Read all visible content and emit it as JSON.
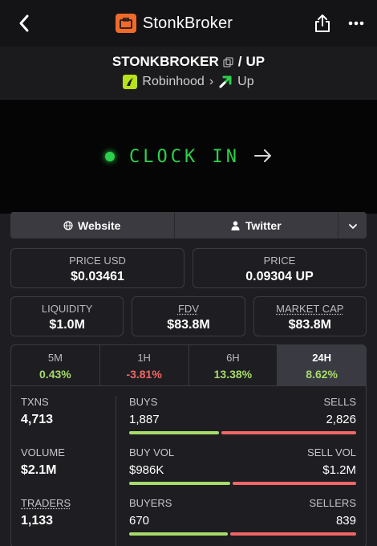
{
  "app": {
    "name": "StonkBroker"
  },
  "pair": {
    "base": "STONKBROKER",
    "separator": "/",
    "quote": "UP",
    "dex": "Robinhood",
    "chain": "Up"
  },
  "banner": {
    "text": "CLOCK IN"
  },
  "links": {
    "website": "Website",
    "twitter": "Twitter"
  },
  "prices": {
    "usd_label": "PRICE USD",
    "usd_value": "$0.03461",
    "native_label": "PRICE",
    "native_value": "0.09304 UP"
  },
  "market": {
    "liquidity_label": "LIQUIDITY",
    "liquidity_value": "$1.0M",
    "fdv_label": "FDV",
    "fdv_value": "$83.8M",
    "mcap_label": "MARKET CAP",
    "mcap_value": "$83.8M"
  },
  "timeframes": [
    {
      "label": "5M",
      "value": "0.43%",
      "trend": "pos"
    },
    {
      "label": "1H",
      "value": "-3.81%",
      "trend": "neg"
    },
    {
      "label": "6H",
      "value": "13.38%",
      "trend": "pos"
    },
    {
      "label": "24H",
      "value": "8.62%",
      "trend": "pos"
    }
  ],
  "active_timeframe": "24H",
  "metrics": {
    "txns_label": "TXNS",
    "txns_value": "4,713",
    "volume_label": "VOLUME",
    "volume_value": "$2.1M",
    "traders_label": "TRADERS",
    "traders_value": "1,133",
    "buys_label": "BUYS",
    "buys_value": "1,887",
    "sells_label": "SELLS",
    "sells_value": "2,826",
    "buys_fraction": 0.4,
    "buyvol_label": "BUY VOL",
    "buyvol_value": "$986K",
    "sellvol_label": "SELL VOL",
    "sellvol_value": "$1.2M",
    "buyvol_fraction": 0.45,
    "buyers_label": "BUYERS",
    "buyers_value": "670",
    "sellers_label": "SELLERS",
    "sellers_value": "839",
    "buyers_fraction": 0.44
  },
  "colors": {
    "accent_green": "#2bd14a",
    "positive": "#a7db6a",
    "negative": "#f26666",
    "brand_orange": "#f16a2a",
    "robinhood_green": "#b8e21b"
  },
  "icons": [
    "back-icon",
    "briefcase-icon",
    "share-icon",
    "more-icon",
    "copy-icon",
    "robinhood-icon",
    "up-arrow-icon",
    "arrow-right-icon",
    "globe-icon",
    "user-icon",
    "chevron-down-icon"
  ]
}
